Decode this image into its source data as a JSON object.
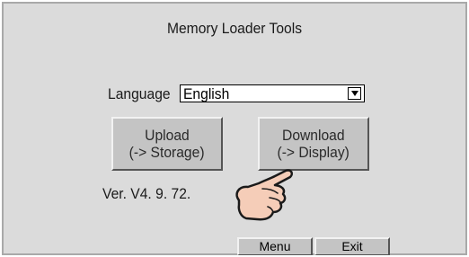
{
  "window": {
    "title": "Memory Loader Tools"
  },
  "language": {
    "label": "Language",
    "value": "English"
  },
  "buttons": {
    "upload": {
      "line1": "Upload",
      "line2": "(-> Storage)"
    },
    "download": {
      "line1": "Download",
      "line2": "(-> Display)"
    },
    "menu": "Menu",
    "exit": "Exit"
  },
  "version": "Ver.  V4. 9. 72.",
  "icons": {
    "pointer": "hand-pointer-icon",
    "dropdown": "dropdown-arrow-icon"
  },
  "colors": {
    "background": "#dbdbdb",
    "button": "#c4c4c4",
    "hand": "#f5cdb8"
  }
}
